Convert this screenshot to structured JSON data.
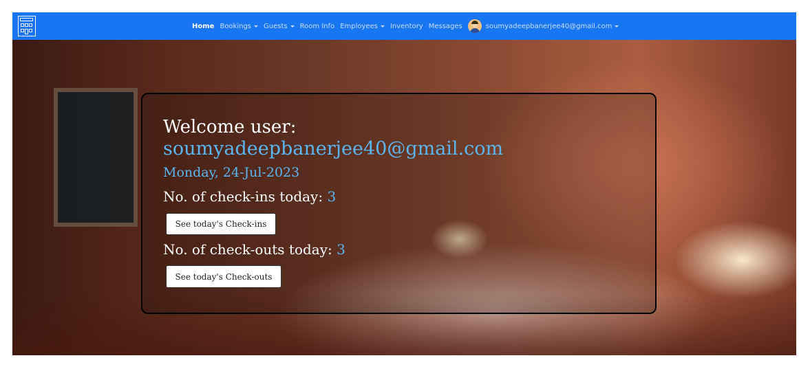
{
  "nav": {
    "items": [
      {
        "label": "Home",
        "dropdown": false,
        "active": true
      },
      {
        "label": "Bookings",
        "dropdown": true
      },
      {
        "label": "Guests",
        "dropdown": true
      },
      {
        "label": "Room Info",
        "dropdown": false
      },
      {
        "label": "Employees",
        "dropdown": true
      },
      {
        "label": "Inventory",
        "dropdown": false
      },
      {
        "label": "Messages",
        "dropdown": false
      }
    ],
    "user_email": "soumyadeepbanerjee40@gmail.com"
  },
  "dashboard": {
    "welcome": "Welcome user:",
    "email": "soumyadeepbanerjee40@gmail.com",
    "date": "Monday, 24-Jul-2023",
    "checkins_label": "No. of check-ins today:",
    "checkins_count": "3",
    "checkins_button": "See today's Check-ins",
    "checkouts_label": "No. of check-outs today:",
    "checkouts_count": "3",
    "checkouts_button": "See today's Check-outs"
  },
  "colors": {
    "navbar": "#1876f3",
    "accent_text": "#5bb6f0"
  }
}
